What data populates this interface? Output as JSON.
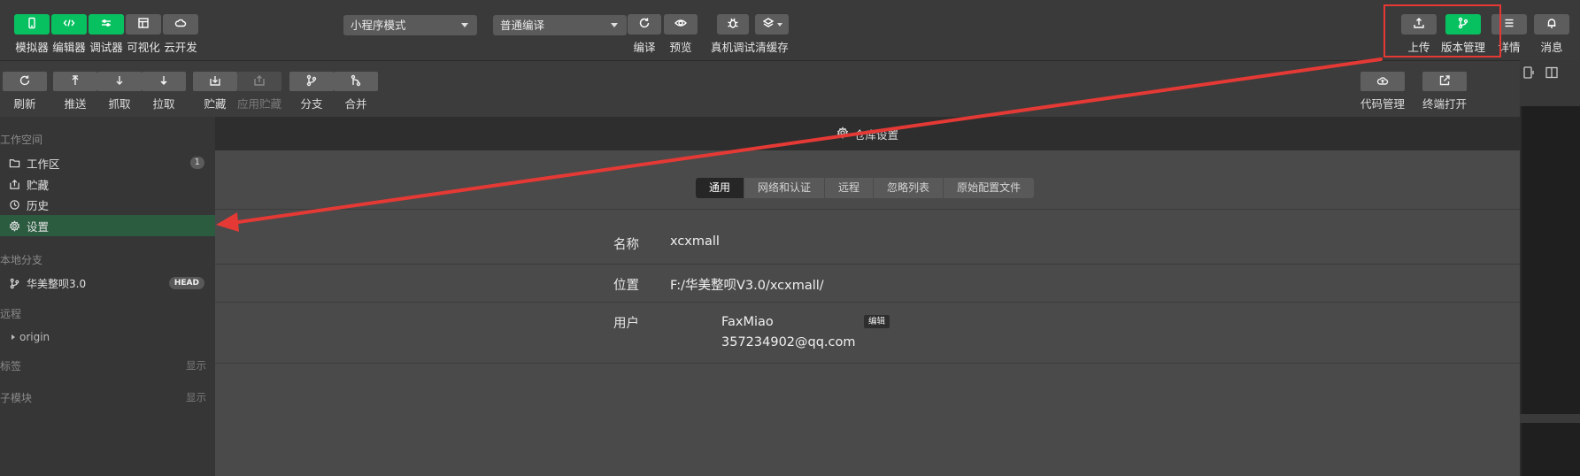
{
  "toolbar": {
    "left_buttons": [
      {
        "label": "模拟器",
        "icon": "phone-icon"
      },
      {
        "label": "编辑器",
        "icon": "code-icon"
      },
      {
        "label": "调试器",
        "icon": "debugger-icon"
      },
      {
        "label": "可视化",
        "icon": "layout-icon"
      },
      {
        "label": "云开发",
        "icon": "cloud-icon"
      }
    ],
    "mode_select": "小程序模式",
    "compile_select": "普通编译",
    "center_buttons": [
      {
        "label": "编译",
        "icon": "refresh-icon"
      },
      {
        "label": "预览",
        "icon": "eye-icon"
      },
      {
        "label": "真机调试",
        "icon": "bug-icon"
      },
      {
        "label": "清缓存",
        "icon": "layers-icon"
      }
    ],
    "right_buttons": [
      {
        "label": "上传",
        "icon": "upload-icon"
      },
      {
        "label": "版本管理",
        "icon": "branch-icon"
      },
      {
        "label": "详情",
        "icon": "menu-icon"
      },
      {
        "label": "消息",
        "icon": "bell-icon"
      }
    ]
  },
  "subtoolbar": {
    "buttons": [
      {
        "label": "刷新",
        "icon": "refresh-icon"
      },
      {
        "label": "推送",
        "icon": "push-icon"
      },
      {
        "label": "抓取",
        "icon": "fetch-icon"
      },
      {
        "label": "拉取",
        "icon": "pull-icon"
      },
      {
        "label": "贮藏",
        "icon": "stash-icon"
      },
      {
        "label": "应用贮藏",
        "icon": "apply-stash-icon"
      },
      {
        "label": "分支",
        "icon": "branch-icon"
      },
      {
        "label": "合并",
        "icon": "merge-icon"
      }
    ],
    "right_buttons": [
      {
        "label": "代码管理",
        "icon": "cloud-upload-icon"
      },
      {
        "label": "终端打开",
        "icon": "external-link-icon"
      }
    ]
  },
  "sidebar": {
    "workspace_title": "工作空间",
    "workspace_items": [
      {
        "label": "工作区",
        "icon": "folder-icon",
        "count": "1"
      },
      {
        "label": "贮藏",
        "icon": "stash-icon"
      },
      {
        "label": "历史",
        "icon": "history-icon"
      },
      {
        "label": "设置",
        "icon": "gear-icon"
      }
    ],
    "local_branch_title": "本地分支",
    "branch": {
      "label": "华美整呗3.0",
      "badge": "HEAD"
    },
    "remote_title": "远程",
    "remote_item": "origin",
    "tags_title": "标签",
    "tags_action": "显示",
    "submodules_title": "子模块",
    "submodules_action": "显示"
  },
  "panel": {
    "header_title": "仓库设置",
    "tabs": [
      "通用",
      "网络和认证",
      "远程",
      "忽略列表",
      "原始配置文件"
    ],
    "active_tab": 0,
    "fields": {
      "name_label": "名称",
      "name_value": "xcxmall",
      "location_label": "位置",
      "location_value": "F:/华美整呗V3.0/xcxmall/",
      "user_label": "用户",
      "user_name": "FaxMiao",
      "user_email": "357234902@qq.com",
      "edit_label": "编辑"
    }
  },
  "colors": {
    "accent_green": "#07c160",
    "annotation_red": "#e53935",
    "active_sidebar": "#2b5c40"
  }
}
